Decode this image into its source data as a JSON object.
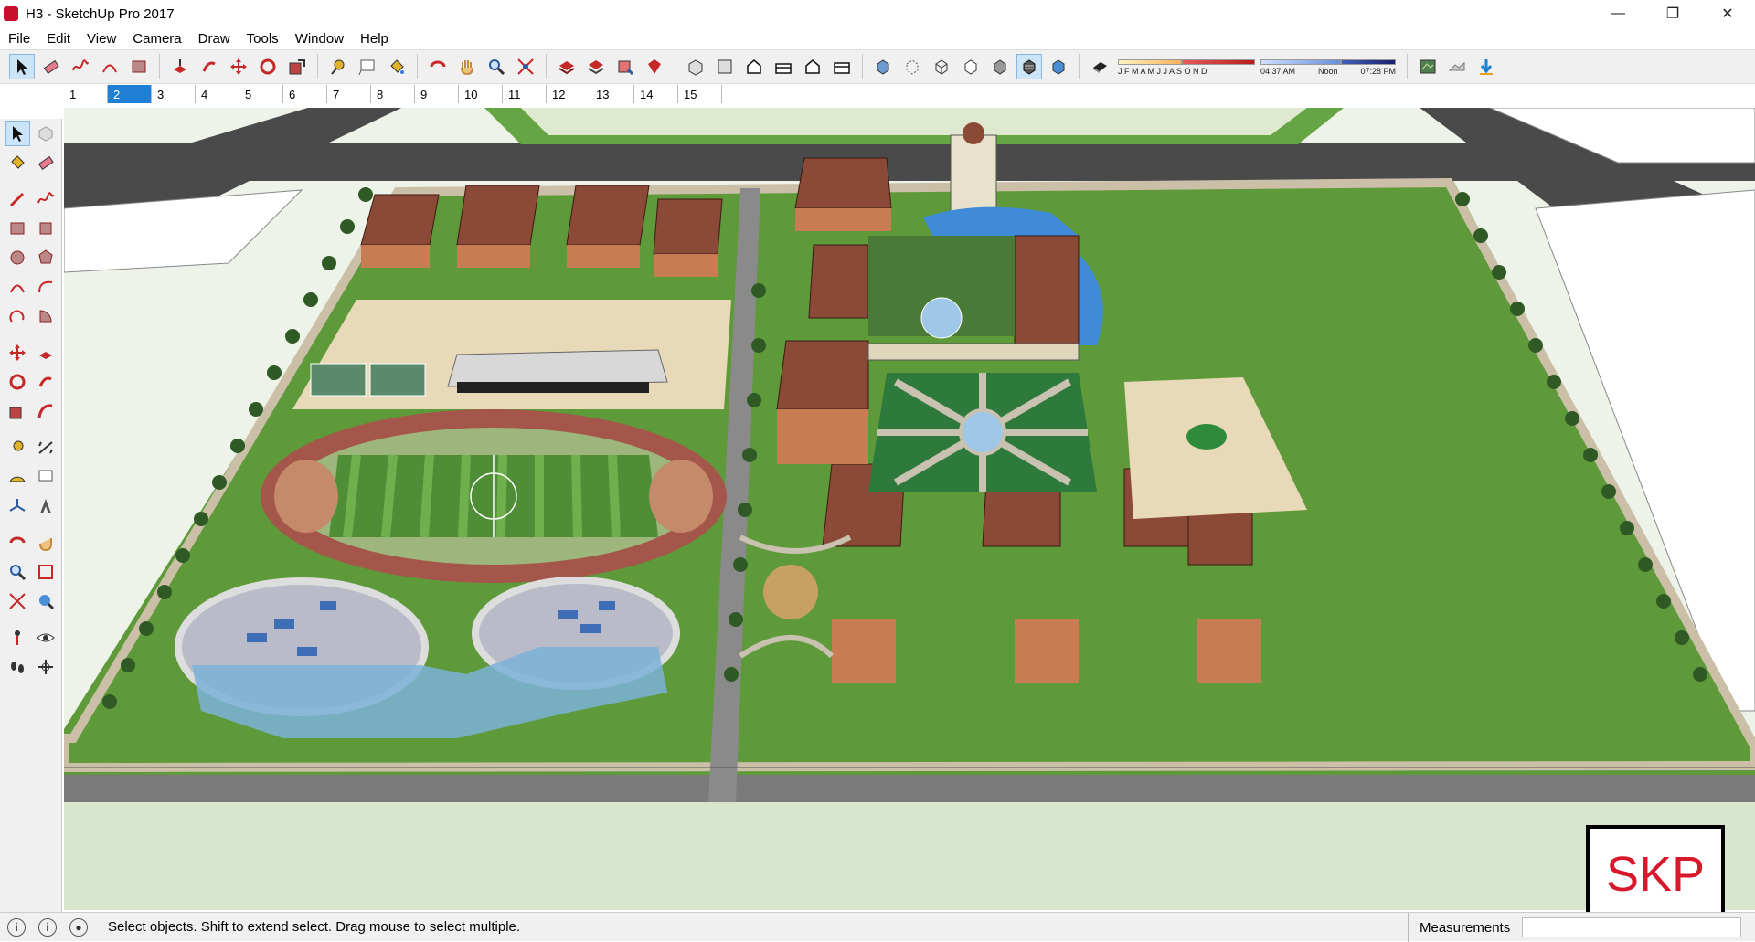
{
  "window": {
    "title": "H3 - SketchUp Pro 2017",
    "controls": [
      "minimize-icon",
      "restore-icon",
      "close-icon"
    ]
  },
  "menu": [
    "File",
    "Edit",
    "View",
    "Camera",
    "Draw",
    "Tools",
    "Window",
    "Help"
  ],
  "shadow": {
    "months": "J F M A M J J A S O N D",
    "time_start": "04:37 AM",
    "time_mid": "Noon",
    "time_end": "07:28 PM"
  },
  "scenes": {
    "tabs": [
      "1",
      "2",
      "3",
      "4",
      "5",
      "6",
      "7",
      "8",
      "9",
      "10",
      "11",
      "12",
      "13",
      "14",
      "15"
    ],
    "active": "2"
  },
  "logo": {
    "text": "SKP"
  },
  "status": {
    "hint": "Select objects. Shift to extend select. Drag mouse to select multiple.",
    "measurements_label": "Measurements",
    "measurements_value": ""
  },
  "colors": {
    "accent": "#1e7fd4",
    "grass": "#5f9a3a",
    "road": "#4a4a4a",
    "roof": "#7a3b2c",
    "water": "#3f8bd8",
    "logo_red": "#d7192b"
  }
}
